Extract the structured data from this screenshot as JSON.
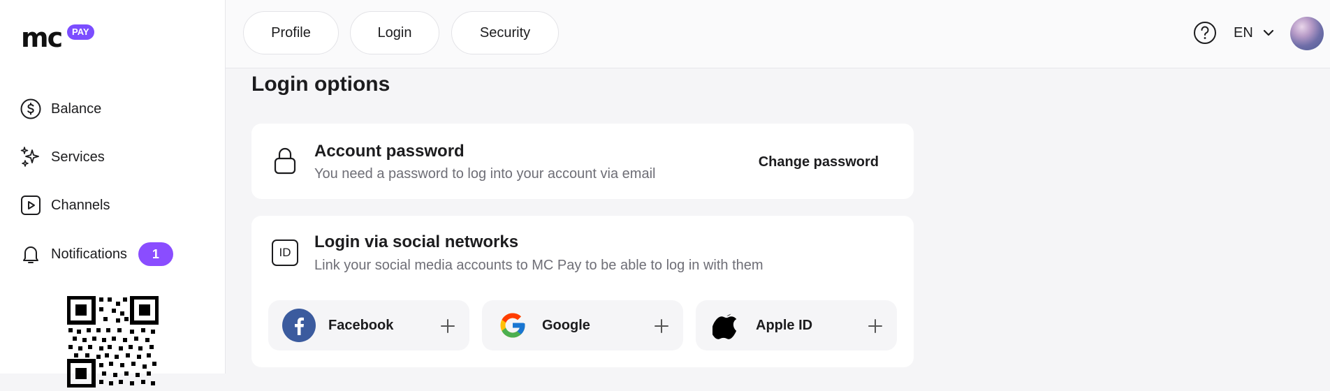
{
  "brand": {
    "logo_text": "mc",
    "logo_badge": "PAY",
    "accent": "#7b4dff"
  },
  "sidebar": {
    "items": [
      {
        "label": "Balance",
        "icon": "dollar-circle-icon"
      },
      {
        "label": "Services",
        "icon": "sparkles-icon"
      },
      {
        "label": "Channels",
        "icon": "play-square-icon"
      },
      {
        "label": "Notifications",
        "icon": "bell-icon",
        "badge": "1"
      }
    ],
    "qr": "qr-code"
  },
  "header": {
    "tabs": [
      {
        "label": "Profile"
      },
      {
        "label": "Login"
      },
      {
        "label": "Security"
      }
    ],
    "language": "EN"
  },
  "main": {
    "title": "Login options",
    "password_card": {
      "title": "Account password",
      "description": "You need a password to log into your account via email",
      "action": "Change password"
    },
    "social_card": {
      "icon_text": "ID",
      "title": "Login via social networks",
      "description": "Link your social media accounts to MC Pay to be able to log in with them",
      "providers": [
        {
          "name": "Facebook",
          "icon": "facebook-icon"
        },
        {
          "name": "Google",
          "icon": "google-icon"
        },
        {
          "name": "Apple ID",
          "icon": "apple-icon"
        }
      ]
    }
  }
}
